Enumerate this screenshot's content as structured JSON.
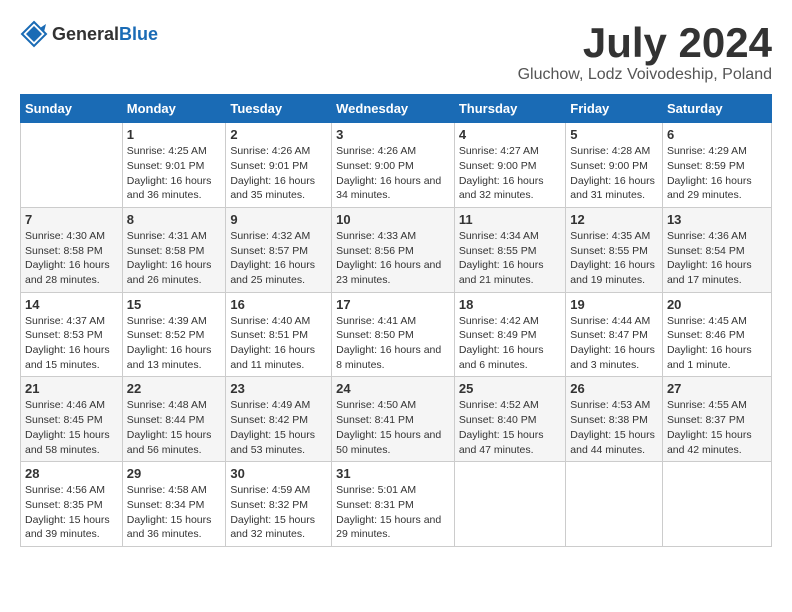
{
  "logo": {
    "general": "General",
    "blue": "Blue"
  },
  "title": "July 2024",
  "subtitle": "Gluchow, Lodz Voivodeship, Poland",
  "days_of_week": [
    "Sunday",
    "Monday",
    "Tuesday",
    "Wednesday",
    "Thursday",
    "Friday",
    "Saturday"
  ],
  "weeks": [
    [
      {
        "day": "",
        "info": ""
      },
      {
        "day": "1",
        "info": "Sunrise: 4:25 AM\nSunset: 9:01 PM\nDaylight: 16 hours\nand 36 minutes."
      },
      {
        "day": "2",
        "info": "Sunrise: 4:26 AM\nSunset: 9:01 PM\nDaylight: 16 hours\nand 35 minutes."
      },
      {
        "day": "3",
        "info": "Sunrise: 4:26 AM\nSunset: 9:00 PM\nDaylight: 16 hours\nand 34 minutes."
      },
      {
        "day": "4",
        "info": "Sunrise: 4:27 AM\nSunset: 9:00 PM\nDaylight: 16 hours\nand 32 minutes."
      },
      {
        "day": "5",
        "info": "Sunrise: 4:28 AM\nSunset: 9:00 PM\nDaylight: 16 hours\nand 31 minutes."
      },
      {
        "day": "6",
        "info": "Sunrise: 4:29 AM\nSunset: 8:59 PM\nDaylight: 16 hours\nand 29 minutes."
      }
    ],
    [
      {
        "day": "7",
        "info": "Sunrise: 4:30 AM\nSunset: 8:58 PM\nDaylight: 16 hours\nand 28 minutes."
      },
      {
        "day": "8",
        "info": "Sunrise: 4:31 AM\nSunset: 8:58 PM\nDaylight: 16 hours\nand 26 minutes."
      },
      {
        "day": "9",
        "info": "Sunrise: 4:32 AM\nSunset: 8:57 PM\nDaylight: 16 hours\nand 25 minutes."
      },
      {
        "day": "10",
        "info": "Sunrise: 4:33 AM\nSunset: 8:56 PM\nDaylight: 16 hours\nand 23 minutes."
      },
      {
        "day": "11",
        "info": "Sunrise: 4:34 AM\nSunset: 8:55 PM\nDaylight: 16 hours\nand 21 minutes."
      },
      {
        "day": "12",
        "info": "Sunrise: 4:35 AM\nSunset: 8:55 PM\nDaylight: 16 hours\nand 19 minutes."
      },
      {
        "day": "13",
        "info": "Sunrise: 4:36 AM\nSunset: 8:54 PM\nDaylight: 16 hours\nand 17 minutes."
      }
    ],
    [
      {
        "day": "14",
        "info": "Sunrise: 4:37 AM\nSunset: 8:53 PM\nDaylight: 16 hours\nand 15 minutes."
      },
      {
        "day": "15",
        "info": "Sunrise: 4:39 AM\nSunset: 8:52 PM\nDaylight: 16 hours\nand 13 minutes."
      },
      {
        "day": "16",
        "info": "Sunrise: 4:40 AM\nSunset: 8:51 PM\nDaylight: 16 hours\nand 11 minutes."
      },
      {
        "day": "17",
        "info": "Sunrise: 4:41 AM\nSunset: 8:50 PM\nDaylight: 16 hours\nand 8 minutes."
      },
      {
        "day": "18",
        "info": "Sunrise: 4:42 AM\nSunset: 8:49 PM\nDaylight: 16 hours\nand 6 minutes."
      },
      {
        "day": "19",
        "info": "Sunrise: 4:44 AM\nSunset: 8:47 PM\nDaylight: 16 hours\nand 3 minutes."
      },
      {
        "day": "20",
        "info": "Sunrise: 4:45 AM\nSunset: 8:46 PM\nDaylight: 16 hours\nand 1 minute."
      }
    ],
    [
      {
        "day": "21",
        "info": "Sunrise: 4:46 AM\nSunset: 8:45 PM\nDaylight: 15 hours\nand 58 minutes."
      },
      {
        "day": "22",
        "info": "Sunrise: 4:48 AM\nSunset: 8:44 PM\nDaylight: 15 hours\nand 56 minutes."
      },
      {
        "day": "23",
        "info": "Sunrise: 4:49 AM\nSunset: 8:42 PM\nDaylight: 15 hours\nand 53 minutes."
      },
      {
        "day": "24",
        "info": "Sunrise: 4:50 AM\nSunset: 8:41 PM\nDaylight: 15 hours\nand 50 minutes."
      },
      {
        "day": "25",
        "info": "Sunrise: 4:52 AM\nSunset: 8:40 PM\nDaylight: 15 hours\nand 47 minutes."
      },
      {
        "day": "26",
        "info": "Sunrise: 4:53 AM\nSunset: 8:38 PM\nDaylight: 15 hours\nand 44 minutes."
      },
      {
        "day": "27",
        "info": "Sunrise: 4:55 AM\nSunset: 8:37 PM\nDaylight: 15 hours\nand 42 minutes."
      }
    ],
    [
      {
        "day": "28",
        "info": "Sunrise: 4:56 AM\nSunset: 8:35 PM\nDaylight: 15 hours\nand 39 minutes."
      },
      {
        "day": "29",
        "info": "Sunrise: 4:58 AM\nSunset: 8:34 PM\nDaylight: 15 hours\nand 36 minutes."
      },
      {
        "day": "30",
        "info": "Sunrise: 4:59 AM\nSunset: 8:32 PM\nDaylight: 15 hours\nand 32 minutes."
      },
      {
        "day": "31",
        "info": "Sunrise: 5:01 AM\nSunset: 8:31 PM\nDaylight: 15 hours\nand 29 minutes."
      },
      {
        "day": "",
        "info": ""
      },
      {
        "day": "",
        "info": ""
      },
      {
        "day": "",
        "info": ""
      }
    ]
  ]
}
